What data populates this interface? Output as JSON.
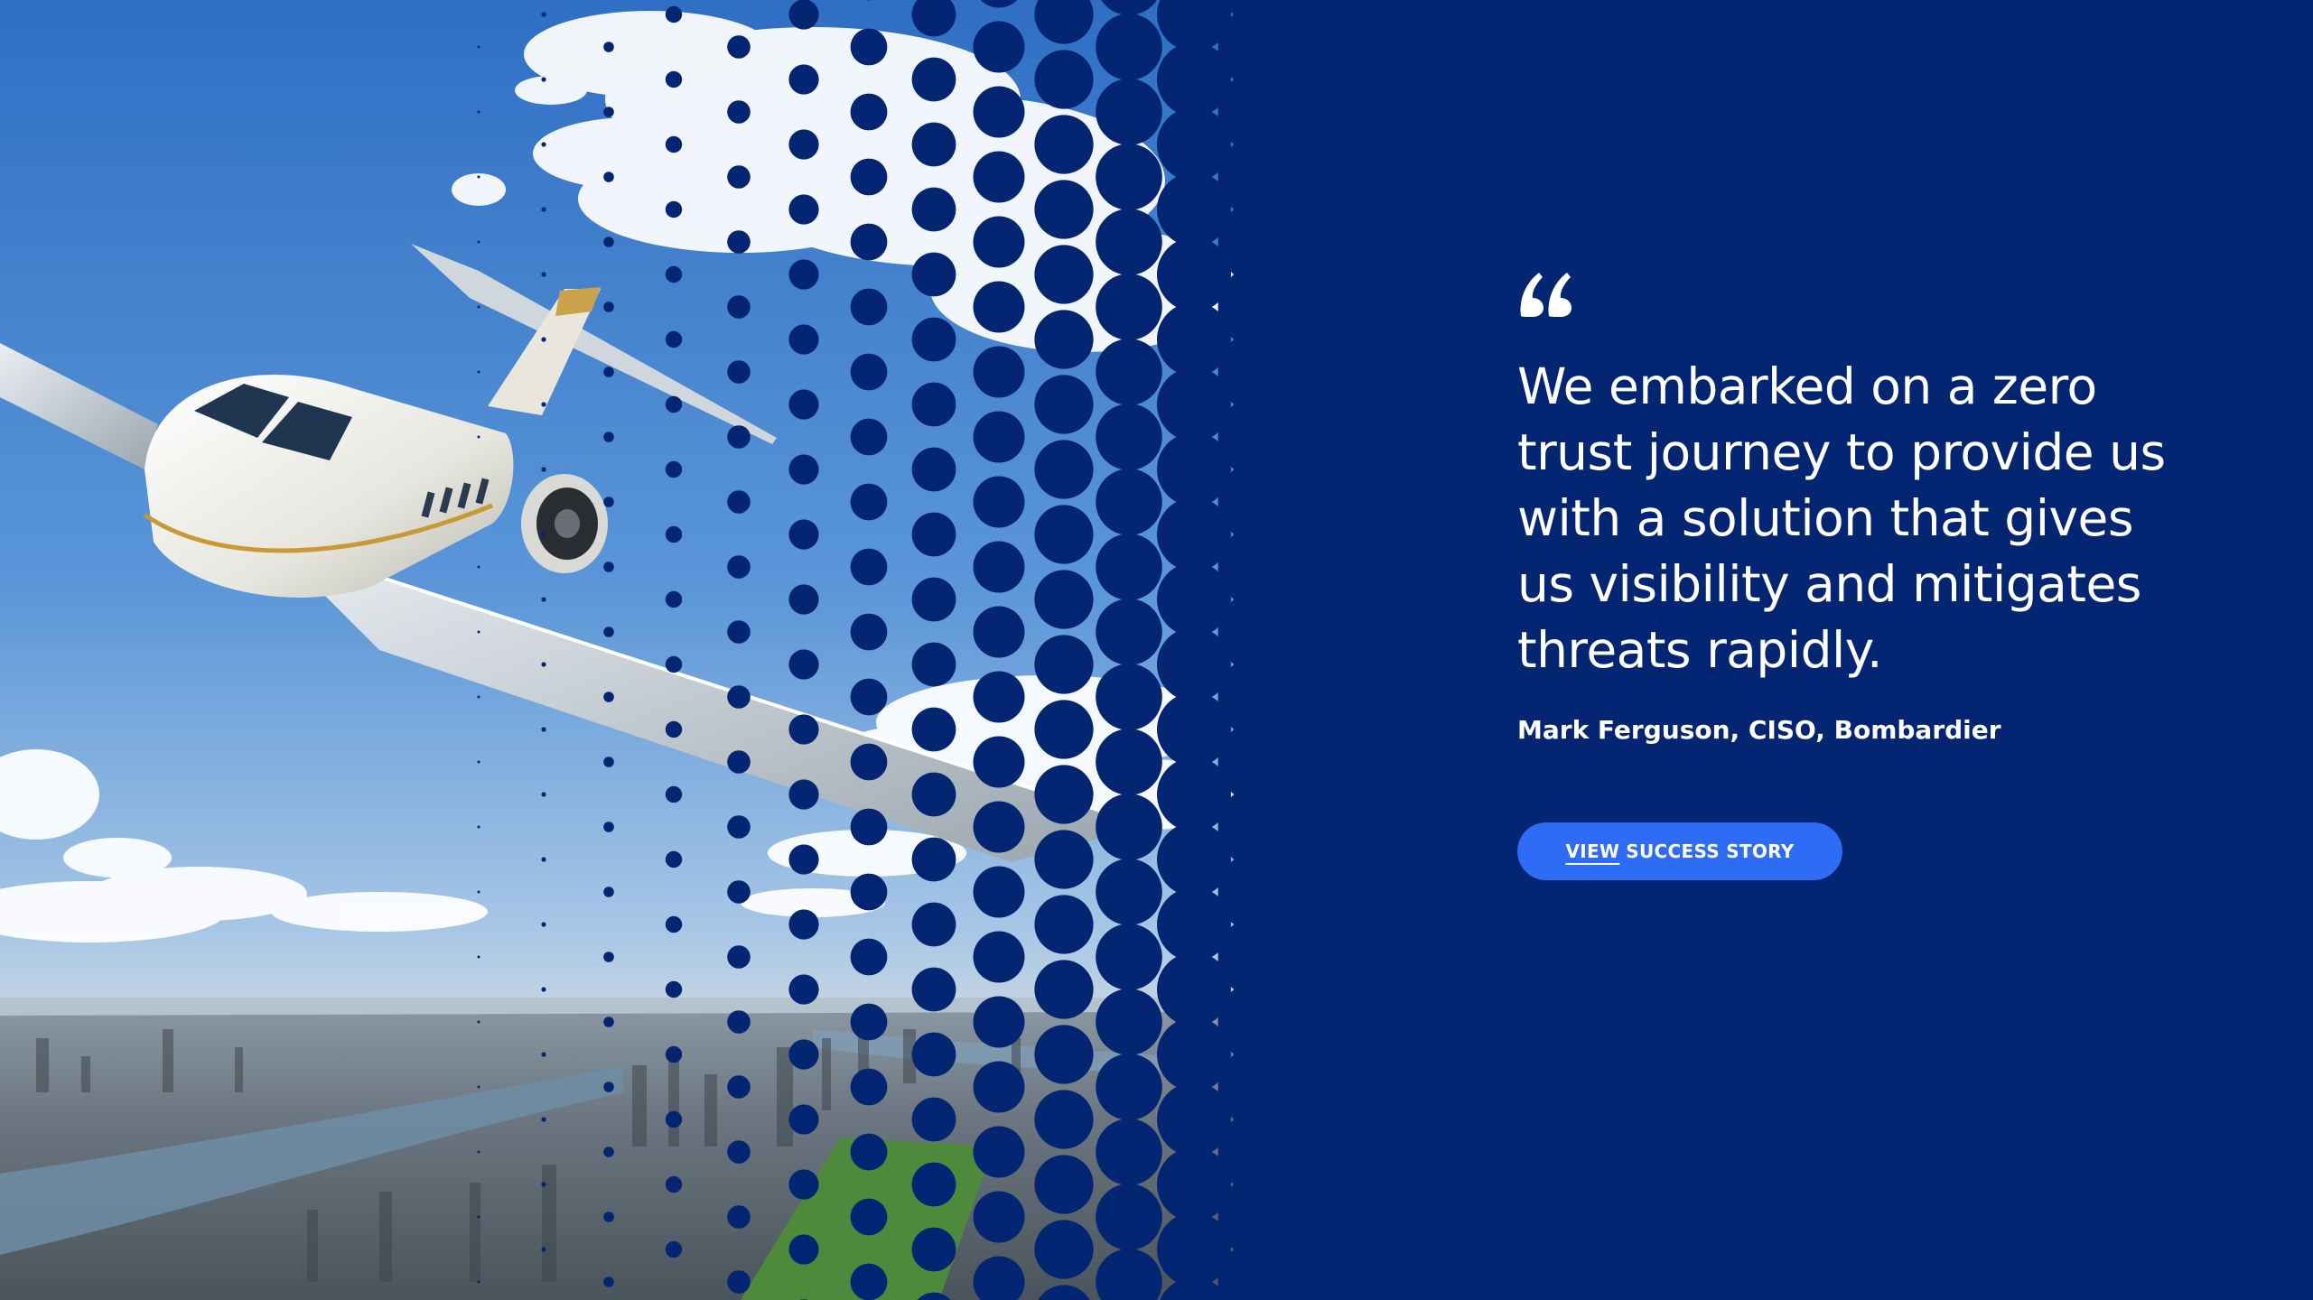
{
  "testimonial": {
    "quote_icon": "quote-mark-icon",
    "quote": "We embarked on a zero trust journey to provide us with a solution that gives us visibility and mitigates threats rapidly.",
    "attribution": "Mark Ferguson, CISO, Bombardier"
  },
  "cta": {
    "label_underlined": "VIEW",
    "label_rest": "SUCCESS STORY"
  },
  "hero_image": {
    "subject": "business-jet-over-city-photo"
  },
  "colors": {
    "background": "#032572",
    "button": "#2f6cf5",
    "text": "#ffffff"
  }
}
